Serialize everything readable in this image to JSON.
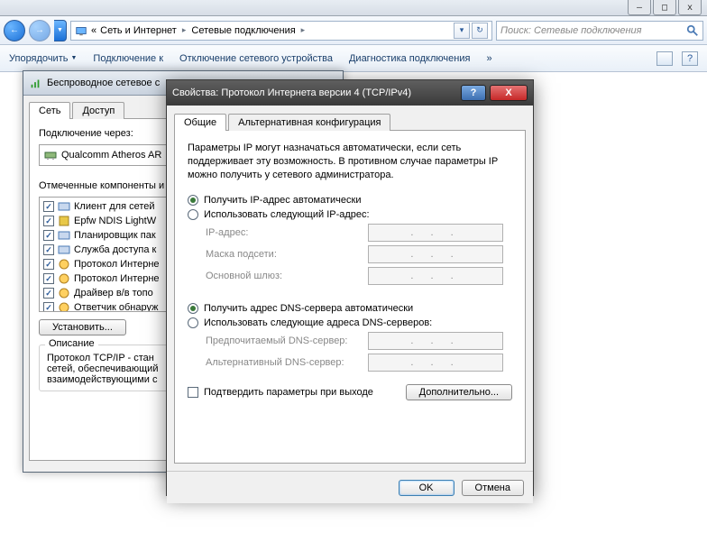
{
  "window": {
    "min": "–",
    "max": "□",
    "close": "x"
  },
  "nav": {
    "back_glyph": "←",
    "fwd_glyph": "→",
    "hist_glyph": "▼",
    "addr_prefix": "«",
    "crumb1": "Сеть и Интернет",
    "crumb2": "Сетевые подключения",
    "sep": "▸",
    "refresh_glyph": "↻",
    "dd_glyph": "▾",
    "search_placeholder": "Поиск: Сетевые подключения"
  },
  "toolbar": {
    "organize": "Упорядочить",
    "connect": "Подключение к",
    "disable": "Отключение сетевого устройства",
    "diag": "Диагностика подключения",
    "more": "»",
    "arrow": "▼"
  },
  "dlg1": {
    "title": "Беспроводное сетевое с",
    "tab_network": "Сеть",
    "tab_access": "Доступ",
    "conn_via": "Подключение через:",
    "device": "Qualcomm Atheros AR",
    "marked": "Отмеченные компоненты и",
    "items": [
      "Клиент для сетей",
      "Epfw NDIS LightW",
      "Планировщик пак",
      "Служба доступа к",
      "Протокол Интерне",
      "Протокол Интерне",
      "Драйвер в/в топо",
      "Ответчик обнаруж"
    ],
    "install": "Установить...",
    "desc_title": "Описание",
    "desc_text": "Протокол TCP/IP - стан\nсетей, обеспечивающий\nвзаимодействующими с"
  },
  "dlg2": {
    "title": "Свойства: Протокол Интернета версии 4 (TCP/IPv4)",
    "help": "?",
    "close": "X",
    "tab_general": "Общие",
    "tab_alt": "Альтернативная конфигурация",
    "desc": "Параметры IP могут назначаться автоматически, если сеть поддерживает эту возможность. В противном случае параметры IP можно получить у сетевого администратора.",
    "ip_auto": "Получить IP-адрес автоматически",
    "ip_manual": "Использовать следующий IP-адрес:",
    "ip_addr": "IP-адрес:",
    "mask": "Маска подсети:",
    "gateway": "Основной шлюз:",
    "dns_auto": "Получить адрес DNS-сервера автоматически",
    "dns_manual": "Использовать следующие адреса DNS-серверов:",
    "dns_pref": "Предпочитаемый DNS-сервер:",
    "dns_alt": "Альтернативный DNS-сервер:",
    "confirm": "Подтвердить параметры при выходе",
    "advanced": "Дополнительно...",
    "ok": "OK",
    "cancel": "Отмена",
    "ip_placeholder": ".   .   ."
  }
}
